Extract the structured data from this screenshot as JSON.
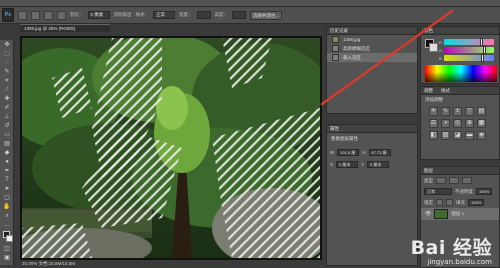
{
  "app": {
    "logo": "Ps",
    "menu_items": []
  },
  "options": {
    "feather_label": "羽化：",
    "feather_value": "0 像素",
    "antialias_label": "消除锯齿",
    "style_label": "样式：",
    "style_value": "正常",
    "width_label": "宽度：",
    "height_label": "高度：",
    "refine_label": "选择并遮住..."
  },
  "document": {
    "tab_title": "1398.jpg @ 25% (RGB/8)",
    "zoom": "25%",
    "status": "25.00%  文档:15.5M/15.5M"
  },
  "toolbar": {
    "tools": [
      "move",
      "marquee",
      "lasso",
      "quick-select",
      "crop",
      "eyedropper",
      "heal",
      "brush",
      "stamp",
      "history-brush",
      "eraser",
      "gradient",
      "blur",
      "dodge",
      "pen",
      "text",
      "path-select",
      "shape",
      "hand",
      "zoom",
      "more",
      "fg-bg",
      "quickmask",
      "screen-mode"
    ]
  },
  "history": {
    "title": "历史记录",
    "items": [
      {
        "label": "1398.jpg",
        "selected": false
      },
      {
        "label": "高斯模糊选区",
        "selected": false
      },
      {
        "label": "载入选区",
        "selected": true
      }
    ]
  },
  "properties": {
    "title": "属性",
    "subtitle": "像素图层属性",
    "fields": [
      {
        "label": "W",
        "value": "101.6 厘"
      },
      {
        "label": "H",
        "value": "67.73 厘"
      },
      {
        "label": "X",
        "value": "0 厘米"
      },
      {
        "label": "Y",
        "value": "0 厘米"
      }
    ]
  },
  "color": {
    "title": "颜色",
    "channels": [
      {
        "label": "R",
        "level": 0.72
      },
      {
        "label": "G",
        "level": 0.78
      },
      {
        "label": "B",
        "level": 0.74
      }
    ]
  },
  "adjustments": {
    "title": "调整",
    "tab_styles": "样式",
    "add_label": "添加调整",
    "icons": [
      "brightness",
      "curves",
      "exposure",
      "vibrance",
      "hue-sat",
      "color-balance",
      "bw",
      "photo-filter",
      "channel-mixer",
      "lookup",
      "invert",
      "posterize",
      "threshold",
      "gradient-map",
      "selective-color"
    ]
  },
  "layers": {
    "title": "图层",
    "kind_label": "类型",
    "blend_mode": "正常",
    "opacity_label": "不透明度",
    "opacity_value": "100%",
    "lock_label": "锁定",
    "fill_label": "填充",
    "fill_value": "100%",
    "items": [
      {
        "label": "图层 1",
        "selected": true
      }
    ]
  },
  "watermark": {
    "main": "Bai 经验",
    "sub": "jingyan.baidu.com"
  },
  "colors": {
    "accent_arrow": "#d93a2f",
    "panel_bg": "#535353",
    "dark_bg": "#3a3a3a"
  }
}
